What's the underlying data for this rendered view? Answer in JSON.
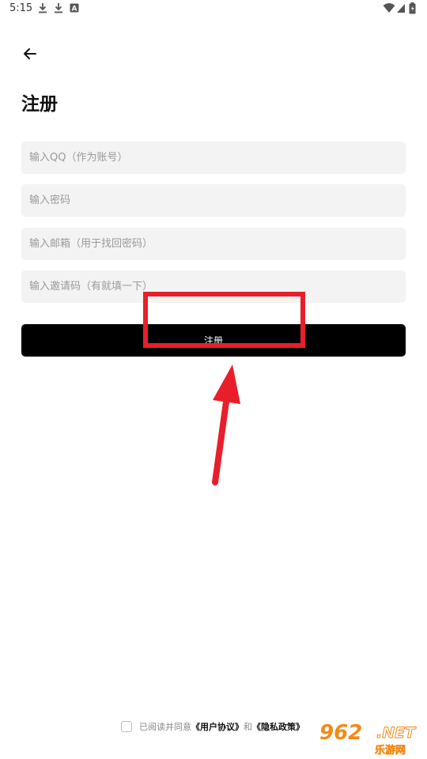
{
  "status_bar": {
    "time": "5:15",
    "icons": [
      "download-icon",
      "download-icon",
      "a-square-icon",
      "wifi-icon",
      "signal-icon",
      "battery-icon"
    ]
  },
  "header": {
    "title": "注册"
  },
  "form": {
    "qq_placeholder": "输入QQ（作为账号）",
    "password_placeholder": "输入密码",
    "email_placeholder": "输入邮箱（用于找回密码）",
    "invite_placeholder": "输入邀请码（有就填一下）",
    "submit_label": "注册"
  },
  "agreement": {
    "prefix": "已阅读并同意",
    "user_agreement": "《用户协议》",
    "conjunction": "和",
    "privacy_policy": "《隐私政策》"
  },
  "watermark": {
    "number": "962",
    "suffix": ".NET",
    "site_name": "乐游网"
  },
  "colors": {
    "annotation": "#e81f2a",
    "button": "#000000",
    "field_background": "#f3f3f3",
    "watermark": "#f28a16"
  }
}
